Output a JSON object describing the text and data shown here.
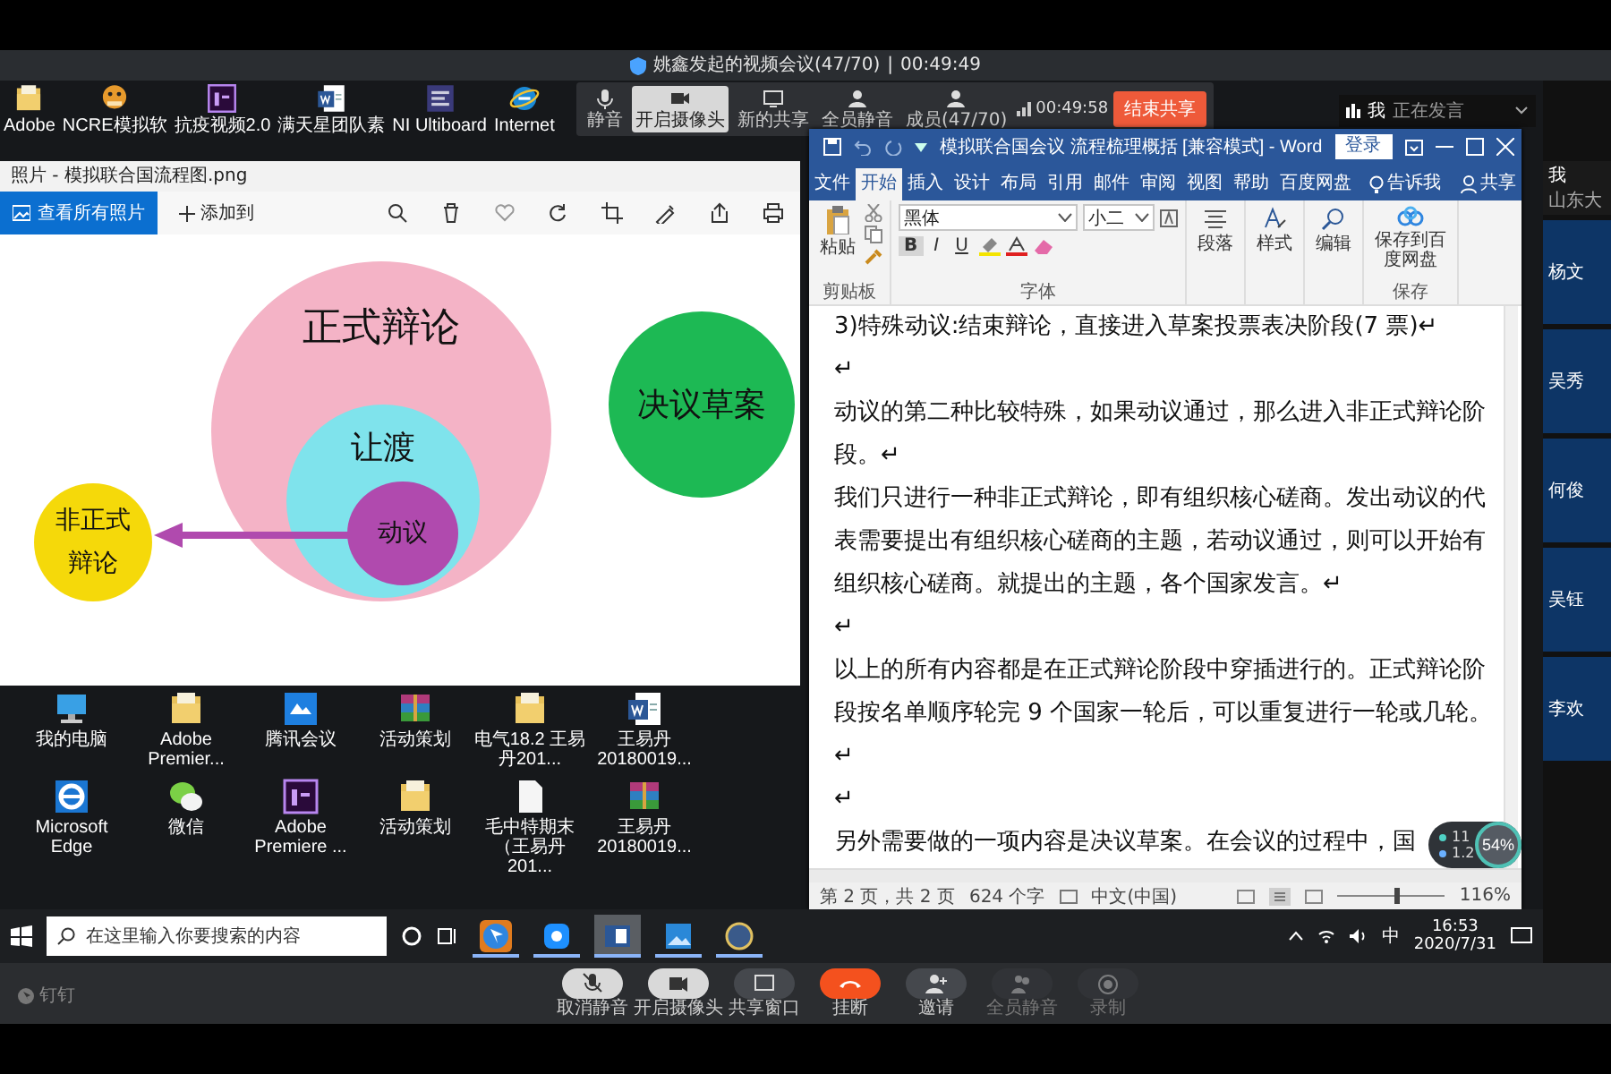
{
  "meeting": {
    "title": "姚鑫发起的视频会议(47/70)",
    "separator": "|",
    "timer": "00:49:49"
  },
  "share_toolbar": {
    "buttons": [
      {
        "label": "静音",
        "kind": "mic",
        "selected": false
      },
      {
        "label": "开启摄像头",
        "kind": "camera",
        "selected": true
      },
      {
        "label": "新的共享",
        "kind": "share",
        "selected": false
      },
      {
        "label": "全员静音",
        "kind": "muteall",
        "selected": false
      },
      {
        "label": "成员(47/70)",
        "kind": "members",
        "selected": false
      }
    ],
    "timer": "00:49:58",
    "end_button": "结束共享"
  },
  "speaking": {
    "name": "我",
    "status": "正在发言"
  },
  "desktop_top_icons": [
    {
      "label": "Adobe",
      "kind": "folder"
    },
    {
      "label": "NCRE模拟软",
      "kind": "mascot"
    },
    {
      "label": "抗疫视频2.0",
      "kind": "premiere"
    },
    {
      "label": "满天星团队素",
      "kind": "word"
    },
    {
      "label": "NI Ultiboard",
      "kind": "app"
    },
    {
      "label": "Internet",
      "kind": "ie"
    }
  ],
  "photo_viewer": {
    "title": "照片 - 模拟联合国流程图.png",
    "view_all": "查看所有照片",
    "add_to": "添加到",
    "diagram": {
      "nodes": [
        {
          "label": "正式辩论",
          "kind": "formal",
          "color": "#f4b3c6"
        },
        {
          "label": "让渡",
          "kind": "yield",
          "color": "#7fe3ec"
        },
        {
          "label": "动议",
          "kind": "motion",
          "color": "#b04aae"
        },
        {
          "label": "决议草案",
          "kind": "draft",
          "color": "#1db954"
        },
        {
          "label": "非正式辩论",
          "kind": "informal",
          "color": "#f5d90a"
        }
      ]
    }
  },
  "word": {
    "title": "模拟联合国会议 流程梳理概括 [兼容模式] - Word",
    "login": "登录",
    "tabs": [
      {
        "label": "文件",
        "selected": false
      },
      {
        "label": "开始",
        "selected": true
      },
      {
        "label": "插入",
        "selected": false
      },
      {
        "label": "设计",
        "selected": false
      },
      {
        "label": "布局",
        "selected": false
      },
      {
        "label": "引用",
        "selected": false
      },
      {
        "label": "邮件",
        "selected": false
      },
      {
        "label": "审阅",
        "selected": false
      },
      {
        "label": "视图",
        "selected": false
      },
      {
        "label": "帮助",
        "selected": false
      },
      {
        "label": "百度网盘",
        "selected": false
      }
    ],
    "tell_me": "告诉我",
    "share": "共享",
    "ribbon": {
      "paste": "粘贴",
      "clipboard_group": "剪贴板",
      "font_name": "黑体",
      "font_size": "小二",
      "format_buttons": [
        "B",
        "I",
        "U"
      ],
      "font_group": "字体",
      "paragraph": "段落",
      "styles": "样式",
      "editing": "编辑",
      "save_baidu": "保存到百度网盘",
      "save_group": "保存"
    },
    "paragraphs": [
      {
        "text": "3)特殊动议:结束辩论，直接进入草案投票表决阶段(7 票)↵"
      },
      {
        "text": "↵"
      },
      {
        "text": "动议的第二种比较特殊，如果动议通过，那么进入非正式辩论阶段。↵"
      },
      {
        "text": "我们只进行一种非正式辩论，即有组织核心磋商。发出动议的代表需要提出有组织核心磋商的主题，若动议通过，则可以开始有组织核心磋商。就提出的主题，各个国家发言。↵"
      },
      {
        "text": "↵"
      },
      {
        "text": "以上的所有内容都是在正式辩论阶段中穿插进行的。正式辩论阶段按名单顺序轮完 9 个国家一轮后，可以重复进行一轮或几轮。↵"
      },
      {
        "text": "↵"
      },
      {
        "text": "另外需要做的一项内容是决议草案。在会议的过程中，国"
      }
    ],
    "status": {
      "page": "第 2 页，共 2 页",
      "words": "624 个字",
      "language": "中文(中国)",
      "zoom": {
        "level": 0.55
      },
      "zoom_text": "116%"
    }
  },
  "network_widget": {
    "upload": "11",
    "download": "1.2",
    "percent": "54%"
  },
  "desktop_bottom_icons": [
    {
      "label": "我的电脑",
      "kind": "pc"
    },
    {
      "label": "Adobe Premier...",
      "kind": "folder"
    },
    {
      "label": "腾讯会议",
      "kind": "tencent"
    },
    {
      "label": "活动策划",
      "kind": "rar"
    },
    {
      "label": "电气18.2 王易丹201...",
      "kind": "folder"
    },
    {
      "label": "王易丹 20180019...",
      "kind": "word"
    },
    {
      "label": "Microsoft Edge",
      "kind": "edge"
    },
    {
      "label": "微信",
      "kind": "wechat"
    },
    {
      "label": "Adobe Premiere ...",
      "kind": "premiere"
    },
    {
      "label": "活动策划",
      "kind": "folder"
    },
    {
      "label": "毛中特期末（王易丹 201...",
      "kind": "file"
    },
    {
      "label": "王易丹 20180019...",
      "kind": "rar"
    }
  ],
  "taskbar": {
    "search_placeholder": "在这里输入你要搜索的内容",
    "apps": [
      {
        "kind": "dingtalk",
        "active": false
      },
      {
        "kind": "skype",
        "active": false
      },
      {
        "kind": "word",
        "active": true
      },
      {
        "kind": "photos",
        "active": false
      },
      {
        "kind": "app",
        "active": false
      }
    ],
    "ime": "中",
    "time": "16:53",
    "date": "2020/7/31"
  },
  "participants": [
    {
      "name": "我",
      "org": "山东大"
    },
    {
      "name": "杨文"
    },
    {
      "name": "吴秀"
    },
    {
      "name": "何俊"
    },
    {
      "name": "吴钰"
    },
    {
      "name": "李欢"
    }
  ],
  "meeting_bar": {
    "app": "钉钉",
    "buttons": [
      {
        "label": "取消静音",
        "kind": "mic",
        "disabled": false
      },
      {
        "label": "开启摄像头",
        "kind": "camera",
        "disabled": false
      },
      {
        "label": "共享窗口",
        "kind": "share",
        "disabled": false
      },
      {
        "label": "挂断",
        "kind": "hangup",
        "disabled": false
      },
      {
        "label": "邀请",
        "kind": "invite",
        "disabled": false
      },
      {
        "label": "全员静音",
        "kind": "muteall",
        "disabled": true
      },
      {
        "label": "录制",
        "kind": "record",
        "disabled": true
      }
    ]
  }
}
